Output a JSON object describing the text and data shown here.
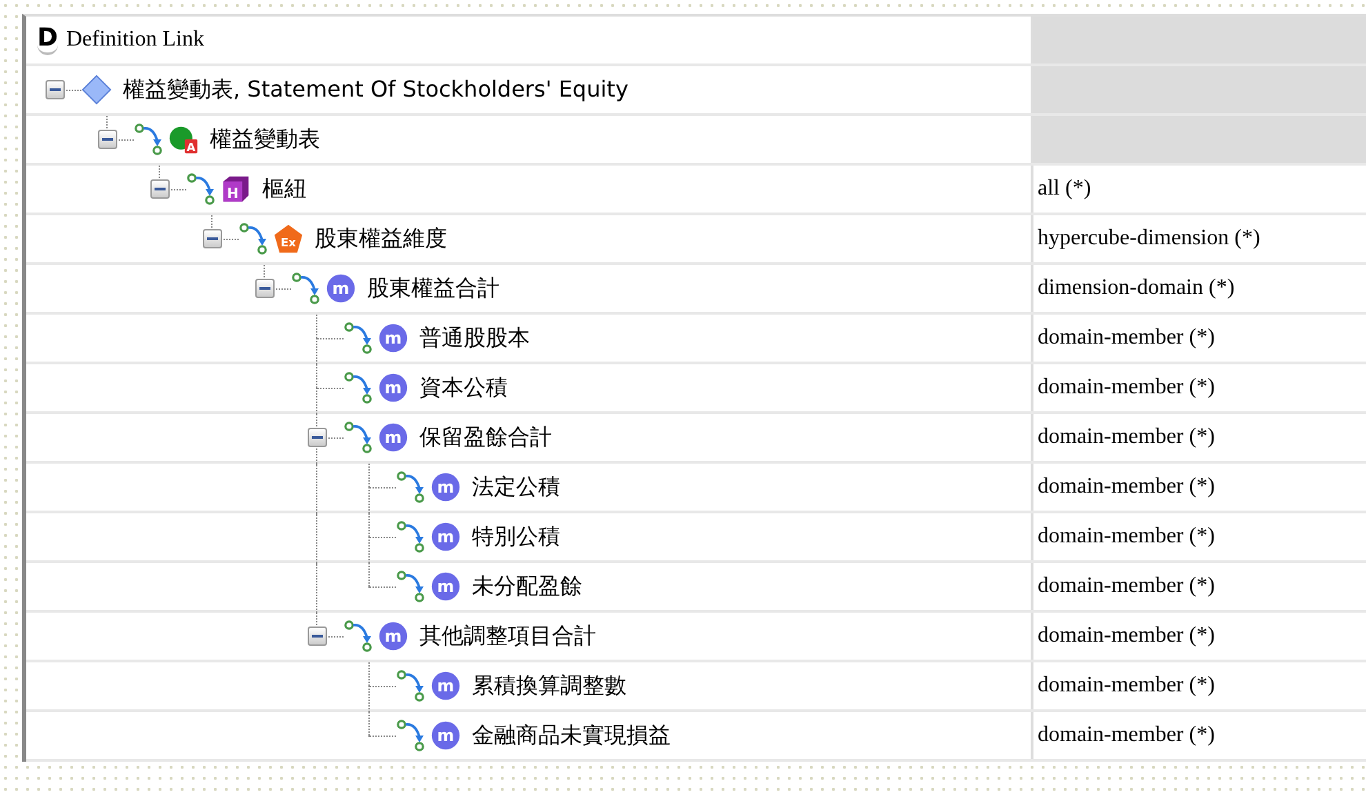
{
  "header": {
    "badge": "D",
    "title": "Definition Link"
  },
  "tree": [
    {
      "label": "權益變動表, Statement Of Stockholders' Equity",
      "kind": "root",
      "expanded": true,
      "children": [
        {
          "label": "權益變動表",
          "kind": "table",
          "badge": "A",
          "expanded": true,
          "children": [
            {
              "label": "樞紐",
              "kind": "hypercube",
              "badge": "H",
              "arcrole": "all (*)",
              "expanded": true,
              "children": [
                {
                  "label": "股東權益維度",
                  "kind": "dimension",
                  "badge": "Ex",
                  "arcrole": "hypercube-dimension (*)",
                  "expanded": true,
                  "children": [
                    {
                      "label": "股東權益合計",
                      "kind": "member",
                      "badge": "m",
                      "arcrole": "dimension-domain (*)",
                      "expanded": true,
                      "children": [
                        {
                          "label": "普通股股本",
                          "kind": "member",
                          "badge": "m",
                          "arcrole": "domain-member (*)"
                        },
                        {
                          "label": "資本公積",
                          "kind": "member",
                          "badge": "m",
                          "arcrole": "domain-member (*)"
                        },
                        {
                          "label": "保留盈餘合計",
                          "kind": "member",
                          "badge": "m",
                          "arcrole": "domain-member (*)",
                          "expanded": true,
                          "children": [
                            {
                              "label": "法定公積",
                              "kind": "member",
                              "badge": "m",
                              "arcrole": "domain-member (*)"
                            },
                            {
                              "label": "特別公積",
                              "kind": "member",
                              "badge": "m",
                              "arcrole": "domain-member (*)"
                            },
                            {
                              "label": "未分配盈餘",
                              "kind": "member",
                              "badge": "m",
                              "arcrole": "domain-member (*)"
                            }
                          ]
                        },
                        {
                          "label": "其他調整項目合計",
                          "kind": "member",
                          "badge": "m",
                          "arcrole": "domain-member (*)",
                          "expanded": true,
                          "children": [
                            {
                              "label": "累積換算調整數",
                              "kind": "member",
                              "badge": "m",
                              "arcrole": "domain-member (*)"
                            },
                            {
                              "label": "金融商品未實現損益",
                              "kind": "member",
                              "badge": "m",
                              "arcrole": "domain-member (*)"
                            }
                          ]
                        }
                      ]
                    }
                  ]
                }
              ]
            }
          ]
        }
      ]
    }
  ]
}
